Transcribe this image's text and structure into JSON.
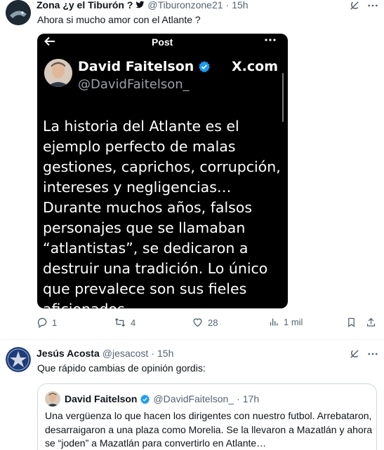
{
  "tweet1": {
    "name": "Zona ¿y el Tiburón ?",
    "handle": "@Tiburonzone21",
    "separator": "·",
    "time": "15h",
    "text": "Ahora si mucho amor con el Atlante ?",
    "embedded": {
      "top_title": "Post",
      "author_name": "David Faitelson",
      "author_handle": "@DavidFaitelson_",
      "site": "X.com",
      "text": "La historia del Atlante es el ejemplo perfecto de malas gestiones, caprichos, corrupción, intereses y negligencias…Durante muchos años, falsos personajes que se llamaban “atlantistas”, se dedicaron a destruir una tradición. Lo único que prevalece son sus fieles aficionados…"
    },
    "actions": {
      "replies": "1",
      "retweets": "4",
      "likes": "28",
      "views": "1 mil"
    }
  },
  "tweet2": {
    "name": "Jesús Acosta",
    "handle": "@jesacost",
    "separator": "·",
    "time": "15h",
    "text": "Que rápido cambias de opinión gordis:",
    "quote": {
      "name": "David Faitelson",
      "handle": "@DavidFaitelson_",
      "separator": "·",
      "time": "17h",
      "text": "Una vergüenza lo que hacen los dirigentes con nuestro futbol. Arrebataron, desarraigaron a una plaza como Morelia. Se la llevaron a Mazatlán y ahora se “joden” a Mazatlán para convertirlo en Atlante…"
    }
  },
  "colors": {
    "accent": "#1d9bf0",
    "muted": "#536471",
    "border": "#cfd9de"
  }
}
